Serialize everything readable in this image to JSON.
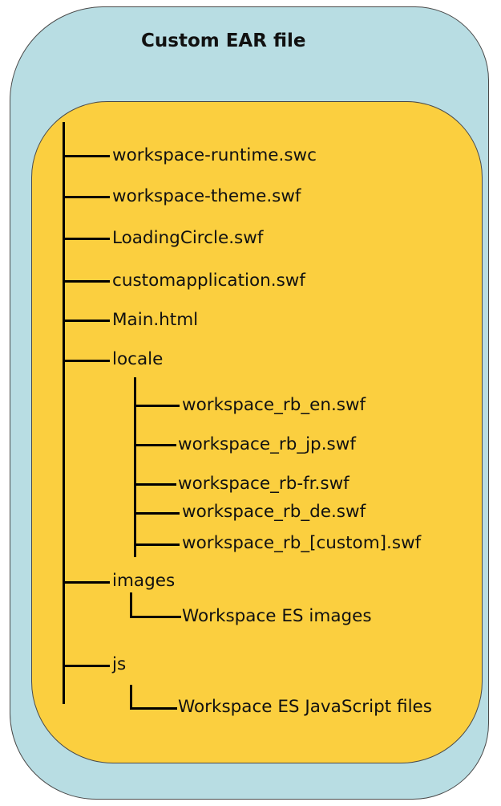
{
  "diagram": {
    "title": "Custom EAR file",
    "root_items": [
      {
        "label": "workspace-runtime.swc"
      },
      {
        "label": "workspace-theme.swf"
      },
      {
        "label": "LoadingCircle.swf"
      },
      {
        "label": "customapplication.swf"
      },
      {
        "label": "Main.html"
      },
      {
        "label": "locale"
      }
    ],
    "locale_items": [
      {
        "label": "workspace_rb_en.swf"
      },
      {
        "label": "workspace_rb_jp.swf"
      },
      {
        "label": "workspace_rb-fr.swf"
      },
      {
        "label": "workspace_rb_de.swf"
      },
      {
        "label": "workspace_rb_[custom].swf"
      }
    ],
    "images_folder": {
      "label": "images",
      "child": "Workspace ES images"
    },
    "js_folder": {
      "label": "js",
      "child": "Workspace ES JavaScript files"
    },
    "colors": {
      "outer_fill": "#b8dde3",
      "inner_fill": "#fbcf3f",
      "line": "#000000",
      "border": "#4a4a4a"
    }
  }
}
